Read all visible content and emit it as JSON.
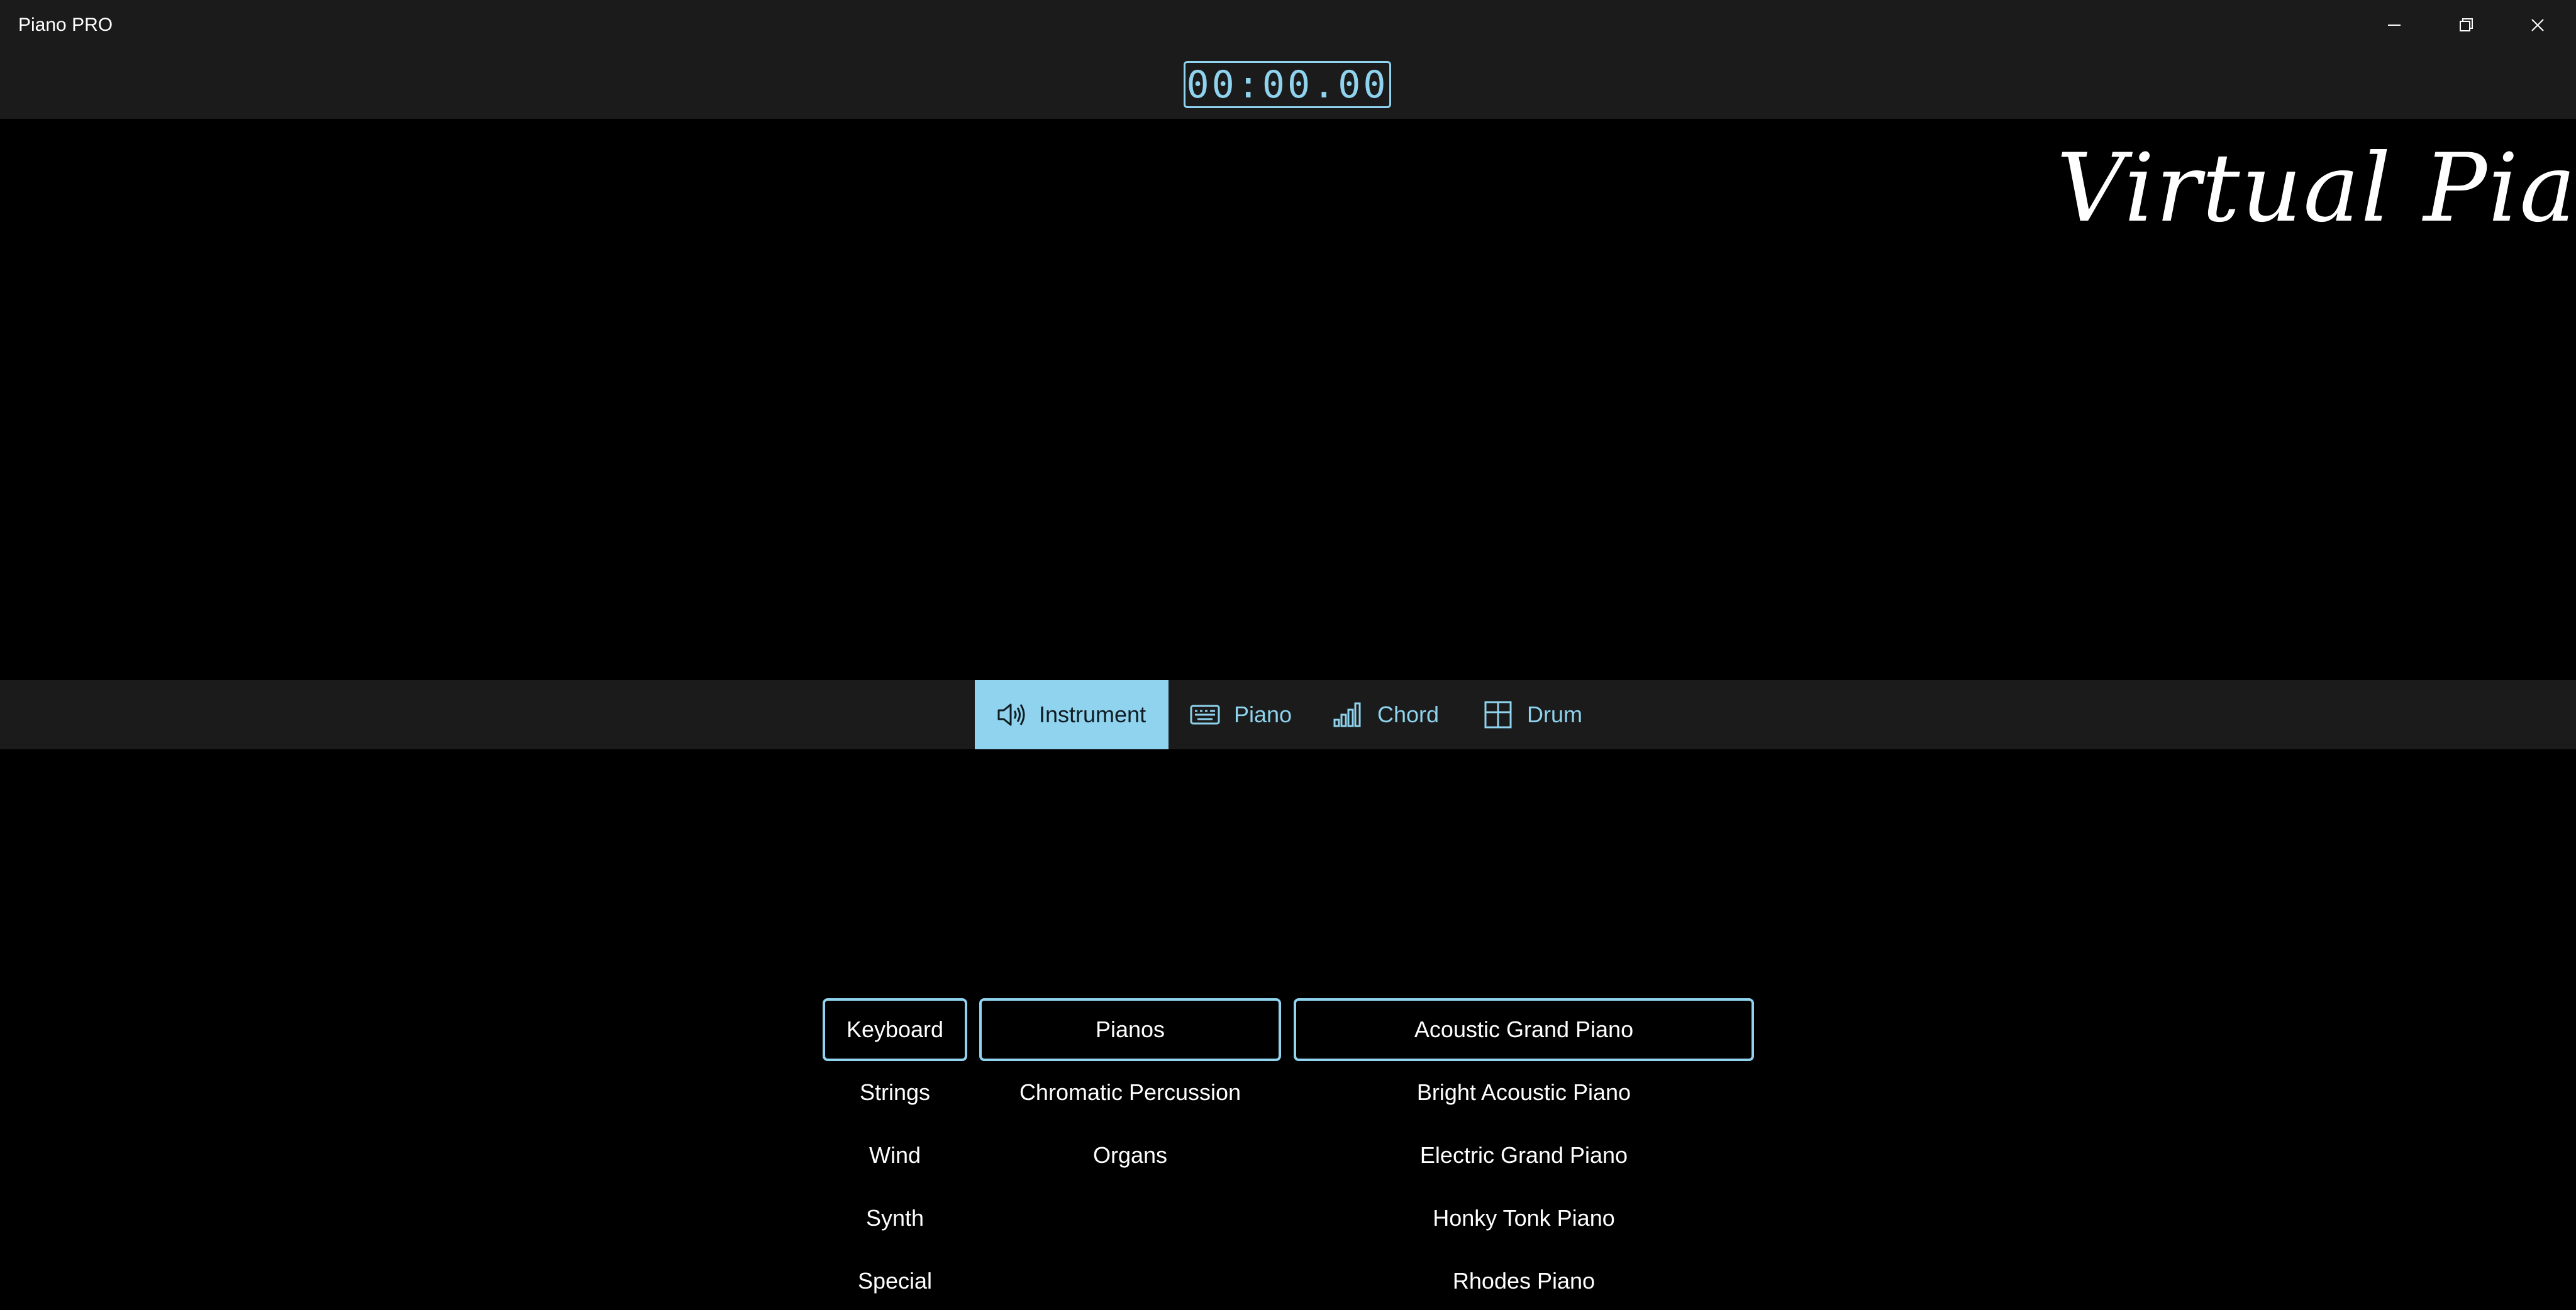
{
  "app": {
    "title": "Piano PRO"
  },
  "timer": {
    "value": "00:00.00"
  },
  "logo": {
    "text": "Virtual Piano"
  },
  "tabs": [
    {
      "label": "Instrument",
      "icon": "speaker-icon",
      "active": true
    },
    {
      "label": "Piano",
      "icon": "keyboard-icon",
      "active": false
    },
    {
      "label": "Chord",
      "icon": "signal-bars-icon",
      "active": false
    },
    {
      "label": "Drum",
      "icon": "grid-icon",
      "active": false
    }
  ],
  "categories": {
    "selected": "Keyboard",
    "items": [
      "Keyboard",
      "Strings",
      "Wind",
      "Synth",
      "Special"
    ]
  },
  "families": {
    "selected": "Pianos",
    "items": [
      "Pianos",
      "Chromatic Percussion",
      "Organs"
    ]
  },
  "instruments": {
    "selected": "Acoustic Grand Piano",
    "items": [
      "Acoustic Grand Piano",
      "Bright Acoustic Piano",
      "Electric Grand Piano",
      "Honky Tonk Piano",
      "Rhodes Piano"
    ]
  },
  "colors": {
    "accent": "#8fd3ee",
    "titlebar": "#1b1b1b",
    "background": "#000000"
  }
}
